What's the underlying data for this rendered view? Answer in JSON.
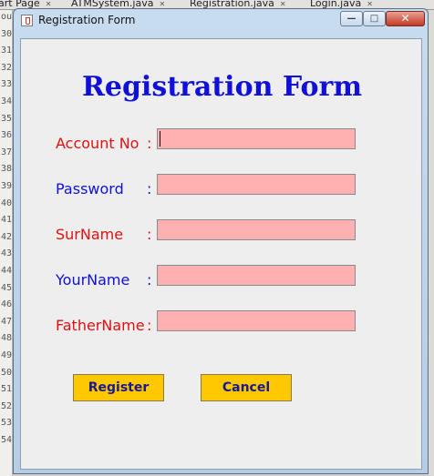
{
  "ide": {
    "tabs": [
      {
        "label": "art Page"
      },
      {
        "label": "ATMSystem.java"
      },
      {
        "label": "Registration.java"
      },
      {
        "label": "Login.java"
      }
    ],
    "close_glyph": "✕",
    "line_numbers": [
      "ou",
      "30",
      "31",
      "32",
      "33",
      "34",
      "35",
      "36",
      "37",
      "38",
      "39",
      "40",
      "41",
      "42",
      "43",
      "44",
      "45",
      "46",
      "47",
      "48",
      "49",
      "50",
      "51",
      "52",
      "53",
      "54"
    ]
  },
  "window": {
    "title": "Registration Form",
    "icon": "java-cup-icon",
    "controls": {
      "minimize": "—",
      "maximize": "□",
      "close": "✕"
    }
  },
  "form": {
    "heading": "Registration Form",
    "fields": [
      {
        "label": "Account No",
        "colon": ":",
        "value": "",
        "label_color": "#e01010"
      },
      {
        "label": "Password",
        "colon": ":",
        "value": "",
        "label_color": "#1010d8"
      },
      {
        "label": "SurName",
        "colon": ":",
        "value": "",
        "label_color": "#e01010"
      },
      {
        "label": "YourName",
        "colon": ":",
        "value": "",
        "label_color": "#1010d8"
      },
      {
        "label": "FatherName",
        "colon": ":",
        "value": "",
        "label_color": "#e01010"
      }
    ],
    "field_bg": "#ffb0b0",
    "buttons": {
      "register": "Register",
      "cancel": "Cancel"
    },
    "button_bg": "#ffc800",
    "heading_color": "#1010d8"
  }
}
